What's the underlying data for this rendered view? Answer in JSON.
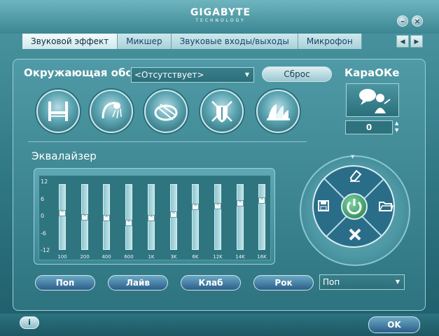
{
  "window": {
    "brand": "GIGABYTE",
    "brand_sub": "TECHNOLOGY",
    "minimize_glyph": "–",
    "close_glyph": "×"
  },
  "tabs": [
    {
      "label": "Звуковой эффект",
      "active": true
    },
    {
      "label": "Микшер"
    },
    {
      "label": "Звуковые входы/выходы"
    },
    {
      "label": "Микрофон"
    }
  ],
  "tab_nav": {
    "prev": "◀",
    "next": "▶"
  },
  "environment": {
    "label": "Окружающая обстановка",
    "selected": "<Отсутствует>",
    "reset_label": "Сброс",
    "presets": [
      {
        "icon": "bathroom-icon"
      },
      {
        "icon": "shower-icon"
      },
      {
        "icon": "stadium-icon"
      },
      {
        "icon": "knight-shield-icon"
      },
      {
        "icon": "opera-house-icon"
      }
    ]
  },
  "karaoke": {
    "title": "КараОКе",
    "icon": "karaoke-people-icon",
    "value": "0",
    "up": "▲",
    "down": "▼"
  },
  "equalizer": {
    "title": "Эквалайзер",
    "db_labels": [
      "12",
      "6",
      "0",
      "-6",
      "-12"
    ],
    "bands": [
      {
        "freq": "100",
        "gain": 1.5
      },
      {
        "freq": "200",
        "gain": 0.0
      },
      {
        "freq": "400",
        "gain": -0.5
      },
      {
        "freq": "600",
        "gain": -2.5
      },
      {
        "freq": "1K",
        "gain": -0.5
      },
      {
        "freq": "3K",
        "gain": 1.0
      },
      {
        "freq": "6K",
        "gain": 4.0
      },
      {
        "freq": "12K",
        "gain": 4.5
      },
      {
        "freq": "14K",
        "gain": 5.5
      },
      {
        "freq": "16K",
        "gain": 6.5
      }
    ],
    "presets": [
      "Поп",
      "Лайв",
      "Клаб",
      "Рок"
    ],
    "selected_preset": "Поп"
  },
  "dial": {
    "center_icon": "power-icon",
    "top_icon": "eraser-icon",
    "left_icon": "save-icon",
    "right_icon": "folder-icon",
    "bottom_icon": "delete-icon",
    "marker": "▼"
  },
  "footer": {
    "info_glyph": "i",
    "ok_label": "OK"
  },
  "colors": {
    "accent": "#2c5e8a",
    "power": "#1e7a4a"
  }
}
